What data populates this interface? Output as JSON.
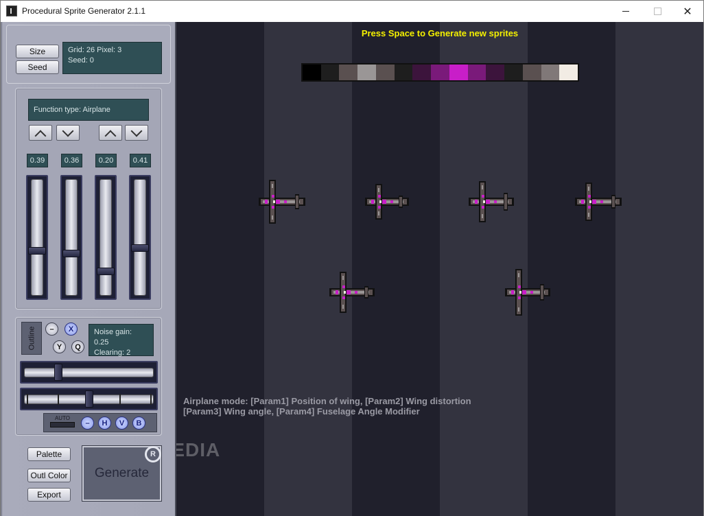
{
  "window": {
    "title": "Procedural Sprite Generator 2.1.1"
  },
  "panel": {
    "size_label": "Size",
    "seed_label": "Seed",
    "info_line1": "Grid: 26 Pixel: 3",
    "info_line2": "Seed: 0",
    "function_type": "Function type: Airplane",
    "slider_values": [
      "0.39",
      "0.36",
      "0.20",
      "0.41"
    ],
    "slider_levels": [
      0.39,
      0.36,
      0.2,
      0.41
    ],
    "outline_label": "Outline",
    "round_buttons": [
      "–",
      "X",
      "Y",
      "Q"
    ],
    "noise_line1": "Noise gain: 0.25",
    "noise_line2": "Clearing: 2",
    "auto_label": "AUTO",
    "bottom_round_buttons": [
      "–",
      "H",
      "V",
      "B"
    ],
    "palette_label": "Palette",
    "outl_color_label": "Outl Color",
    "export_label": "Export",
    "generate_label": "Generate",
    "r_label": "R"
  },
  "canvas": {
    "hint_top": "Press Space to Generate new sprites",
    "mode_line1": "Airplane mode: [Param1] Position of wing, [Param2] Wing distortion",
    "mode_line2": "[Param3] Wing angle, [Param4] Fuselage Angle Modifier",
    "stripe_colors": [
      "#20202c",
      "#33333f"
    ],
    "palette_colors": [
      "#000000",
      "#1e1e1e",
      "#5a5050",
      "#9a9696",
      "#5a5050",
      "#1e1e1e",
      "#3c143c",
      "#7a1a7a",
      "#c81ec8",
      "#7a1a7a",
      "#3c143c",
      "#1e1e1e",
      "#5a5050",
      "#807878",
      "#f2ece4"
    ],
    "watermark": "SOFTPEDIA"
  },
  "colors": {
    "accent_yellow": "#f4f000",
    "display_bg": "#2f4f55",
    "sprite_magenta": "#c81ec8"
  }
}
